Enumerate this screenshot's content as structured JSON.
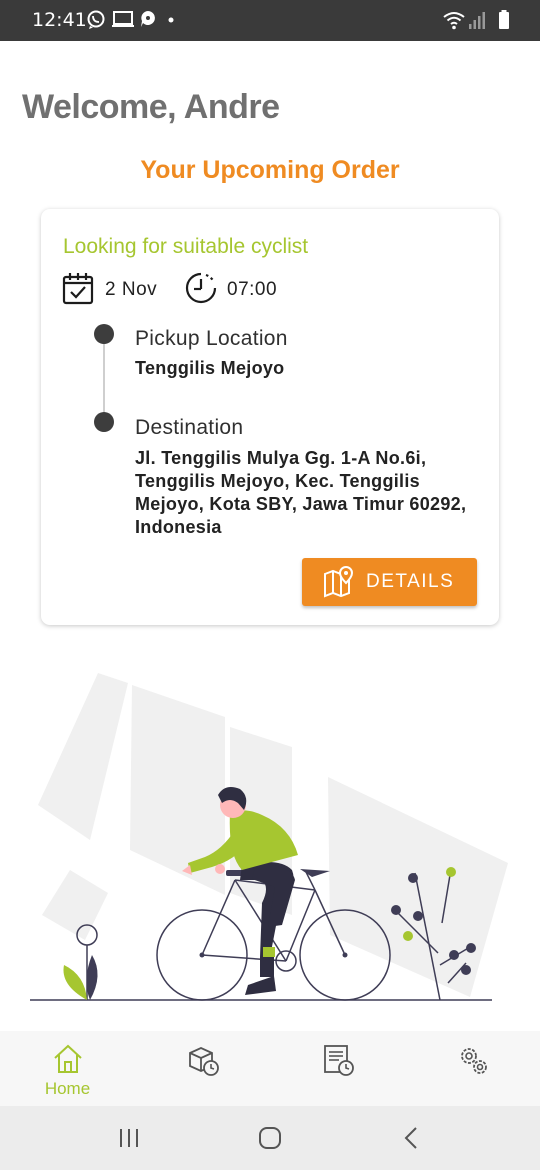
{
  "status_bar": {
    "time": "12:41",
    "left_icons": [
      "whatsapp-icon",
      "monitor-icon",
      "chat-icon",
      "dot-icon"
    ],
    "right_icons": [
      "wifi-icon",
      "signal-icon",
      "battery-icon"
    ]
  },
  "header": {
    "welcome": "Welcome, Andre",
    "section_title": "Your Upcoming Order"
  },
  "order": {
    "status": "Looking for suitable cyclist",
    "date": "2 Nov",
    "time": "07:00",
    "pickup_label": "Pickup Location",
    "pickup_value": "Tenggilis Mejoyo",
    "destination_label": "Destination",
    "destination_value": "Jl. Tenggilis Mulya Gg. 1-A No.6i, Tenggilis Mejoyo, Kec. Tenggilis Mejoyo, Kota SBY, Jawa Timur 60292, Indonesia",
    "details_button": "DETAILS"
  },
  "bottom_nav": {
    "items": [
      {
        "label": "Home",
        "icon": "home-icon",
        "active": true
      },
      {
        "label": "",
        "icon": "package-history-icon",
        "active": false
      },
      {
        "label": "",
        "icon": "order-history-icon",
        "active": false
      },
      {
        "label": "",
        "icon": "settings-icon",
        "active": false
      }
    ]
  },
  "system_nav": {
    "buttons": [
      "recent-apps-icon",
      "home-button-icon",
      "back-icon"
    ]
  },
  "colors": {
    "accent_orange": "#ef8b22",
    "accent_green": "#a6c630",
    "heading_gray": "#707070",
    "status_bar": "#3a3a3a"
  }
}
